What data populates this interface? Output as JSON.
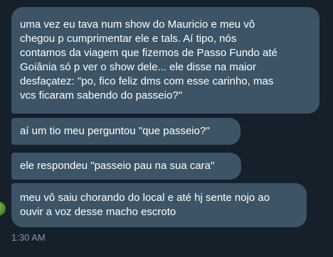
{
  "messages": [
    {
      "text": "uma vez eu tava num show do Mauricio e meu vô\nchegou p cumprimentar ele e tals. Aí tipo, nós\ncontamos da viagem que fizemos de Passo Fundo até\nGoiânia só p ver o show dele... ele disse na maior\ndesfaçatez: \"po, fico feliz dms com esse carinho, mas\nvcs ficaram sabendo do passeio?\""
    },
    {
      "text": "aí um tio meu perguntou \"que passeio?\""
    },
    {
      "text": "ele respondeu \"passeio pau na sua cara\""
    },
    {
      "text": "meu vô saiu chorando do local e até hj sente nojo ao\nouvir a voz desse macho escroto"
    }
  ],
  "timestamp": "1:30 AM",
  "colors": {
    "background": "#15202b",
    "bubble": "#3d5466",
    "text": "#ffffff",
    "timestamp": "#8899a6"
  }
}
